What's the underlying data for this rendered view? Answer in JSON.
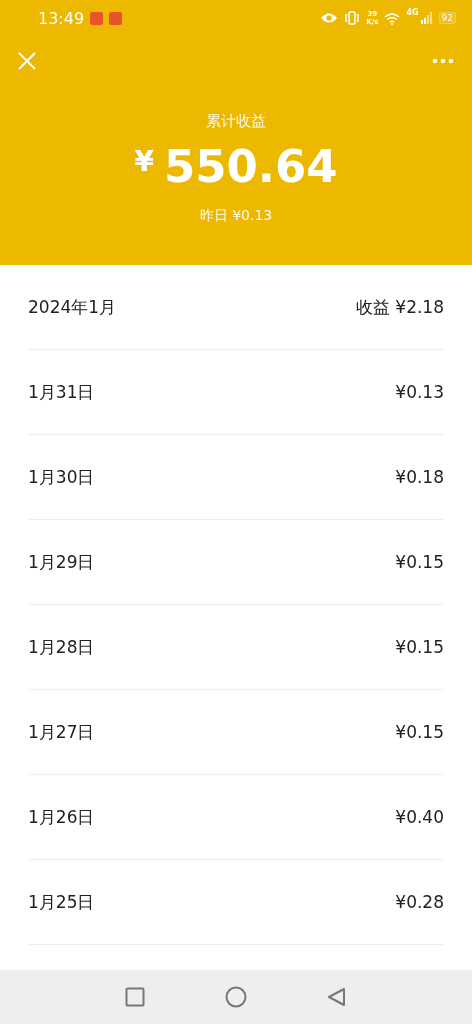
{
  "status_bar": {
    "time": "13:49",
    "speed_value": "39",
    "speed_unit": "K/s",
    "network": "4G",
    "battery": "92"
  },
  "header": {
    "title": "累计收益",
    "total_symbol": "¥",
    "total": "550.64",
    "yesterday": "昨日 ¥0.13"
  },
  "summary": {
    "month": "2024年1月",
    "label": "收益 ¥2.18"
  },
  "rows": [
    {
      "date": "1月31日",
      "amount": "¥0.13"
    },
    {
      "date": "1月30日",
      "amount": "¥0.18"
    },
    {
      "date": "1月29日",
      "amount": "¥0.15"
    },
    {
      "date": "1月28日",
      "amount": "¥0.15"
    },
    {
      "date": "1月27日",
      "amount": "¥0.15"
    },
    {
      "date": "1月26日",
      "amount": "¥0.40"
    },
    {
      "date": "1月25日",
      "amount": "¥0.28"
    }
  ]
}
